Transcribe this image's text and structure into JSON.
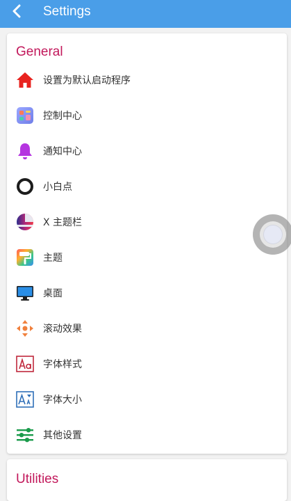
{
  "appbar": {
    "title": "Settings",
    "back_icon": "chevron-left-icon"
  },
  "general": {
    "title": "General",
    "items": [
      {
        "label": "设置为默认启动程序",
        "icon": "home-icon"
      },
      {
        "label": "控制中心",
        "icon": "control-center-icon"
      },
      {
        "label": "通知中心",
        "icon": "bell-icon"
      },
      {
        "label": "小白点",
        "icon": "ring-icon"
      },
      {
        "label": "X 主题栏",
        "icon": "half-circle-icon"
      },
      {
        "label": "主题",
        "icon": "paint-roller-icon"
      },
      {
        "label": "桌面",
        "icon": "monitor-icon"
      },
      {
        "label": "滚动效果",
        "icon": "move-arrows-icon"
      },
      {
        "label": "字体样式",
        "icon": "font-style-icon"
      },
      {
        "label": "字体大小",
        "icon": "font-size-icon"
      },
      {
        "label": "其他设置",
        "icon": "sliders-icon"
      }
    ]
  },
  "utilities": {
    "title": "Utilities"
  },
  "colors": {
    "appbar": "#4a9ee8",
    "section_title": "#c2185b",
    "background": "#f2f2f2"
  }
}
